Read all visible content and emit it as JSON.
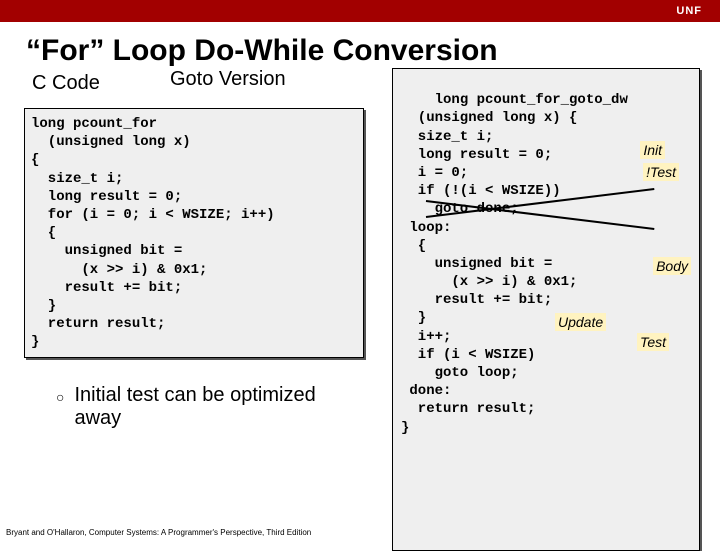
{
  "topbar": {
    "brand": "UNF"
  },
  "title": "“For” Loop Do-While Conversion",
  "labels": {
    "ccode": "C Code",
    "goto": "Goto Version"
  },
  "left_code": "long pcount_for\n  (unsigned long x)\n{\n  size_t i;\n  long result = 0;\n  for (i = 0; i < WSIZE; i++)\n  {\n    unsigned bit =\n      (x >> i) & 0x1;\n    result += bit;\n  }\n  return result;\n}",
  "right_code": "long pcount_for_goto_dw\n  (unsigned long x) {\n  size_t i;\n  long result = 0;\n  i = 0;\n  if (!(i < WSIZE))\n    goto done;\n loop:\n  {\n    unsigned bit =\n      (x >> i) & 0x1;\n    result += bit;\n  }\n  i++;\n  if (i < WSIZE)\n    goto loop;\n done:\n  return result;\n}",
  "annotations": {
    "init": "Init",
    "ntest": "!Test",
    "body": "Body",
    "update": "Update",
    "test": "Test"
  },
  "bullet": "Initial test can be optimized away",
  "footer": "Bryant and O'Hallaron, Computer Systems: A Programmer's Perspective, Third Edition"
}
